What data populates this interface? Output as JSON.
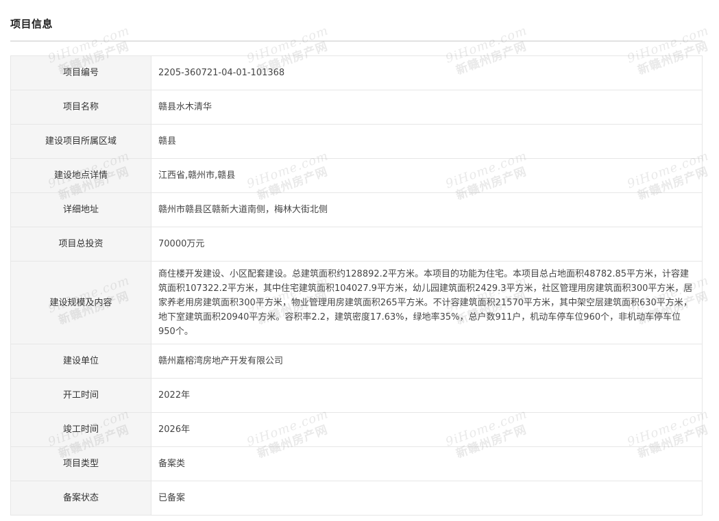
{
  "section": {
    "title": "项目信息"
  },
  "rows": [
    {
      "label": "项目编号",
      "value": "2205-360721-04-01-101368"
    },
    {
      "label": "项目名称",
      "value": "赣县水木清华"
    },
    {
      "label": "建设项目所属区域",
      "value": "赣县"
    },
    {
      "label": "建设地点详情",
      "value": "江西省,赣州市,赣县"
    },
    {
      "label": "详细地址",
      "value": "赣州市赣县区赣新大道南侧，梅林大街北侧"
    },
    {
      "label": "项目总投资",
      "value": "70000万元"
    },
    {
      "label": "建设规模及内容",
      "value": "商住楼开发建设、小区配套建设。总建筑面积约128892.2平方米。本项目的功能为住宅。本项目总占地面积48782.85平方米，计容建筑面积107322.2平方米，其中住宅建筑面积104027.9平方米，幼儿园建筑面积2429.3平方米，社区管理用房建筑面积300平方米，居家养老用房建筑面积300平方米，物业管理用房建筑面积265平方米。不计容建筑面积21570平方米，其中架空层建筑面积630平方米，地下室建筑面积20940平方米。容积率2.2，建筑密度17.63%，绿地率35%，总户数911户，机动车停车位960个，非机动车停车位950个。"
    },
    {
      "label": "建设单位",
      "value": "赣州嘉榕湾房地产开发有限公司"
    },
    {
      "label": "开工时间",
      "value": "2022年"
    },
    {
      "label": "竣工时间",
      "value": "2026年"
    },
    {
      "label": "项目类型",
      "value": "备案类"
    },
    {
      "label": "备案状态",
      "value": "已备案"
    }
  ],
  "watermark": {
    "top_text": "9iHome.com",
    "bottom_text": "新赣州房产网"
  }
}
